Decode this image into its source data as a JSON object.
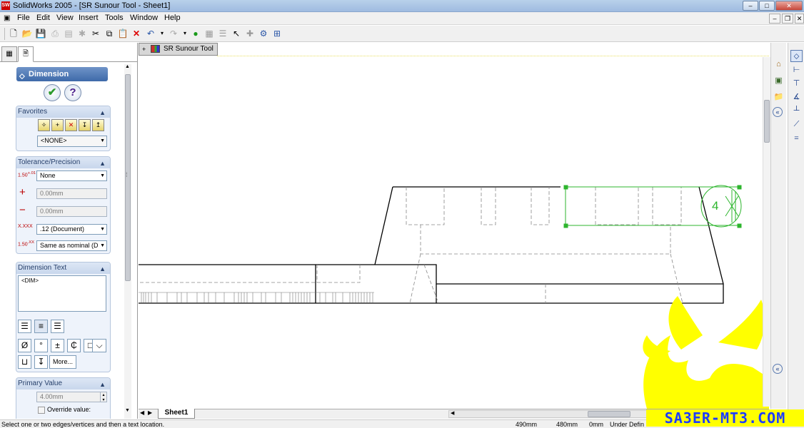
{
  "window": {
    "title": "SolidWorks 2005 - [SR Sunour Tool - Sheet1]",
    "app_icon": "SW"
  },
  "menu": [
    "File",
    "Edit",
    "View",
    "Insert",
    "Tools",
    "Window",
    "Help"
  ],
  "property_manager": {
    "title": "Dimension",
    "ok_glyph": "✔",
    "help_glyph": "?",
    "favorites": {
      "label": "Favorites",
      "selected": "<NONE>"
    },
    "tolerance": {
      "label": "Tolerance/Precision",
      "type": "None",
      "plus": "0.00mm",
      "minus": "0.00mm",
      "precision": ".12 (Document)",
      "tol_precision": "Same as nominal (D",
      "plus_glyph": "+",
      "minus_glyph": "−"
    },
    "dimension_text": {
      "label": "Dimension Text",
      "value": "<DIM>",
      "more_button": "More...",
      "symbols": [
        "Ø",
        "°",
        "±",
        "₵",
        "□",
        "⌵"
      ]
    },
    "primary_value": {
      "label": "Primary Value",
      "value": "4.00mm",
      "override_label": "Override value:"
    }
  },
  "document": {
    "tab_title": "SR Sunour Tool",
    "dimension_text": "4",
    "sheet_tab": "Sheet1"
  },
  "status": {
    "message": "Select one or two edges/vertices and then a text location.",
    "x": "490mm",
    "y": "480mm",
    "z": "0mm",
    "state": "Under Defin"
  },
  "watermark": "SA3ER-MT3.COM",
  "colors": {
    "selection": "#2db52d",
    "watermark_bg": "#ffff00",
    "watermark_text": "#1c3cff",
    "pm_title": "#3e6aa9"
  }
}
